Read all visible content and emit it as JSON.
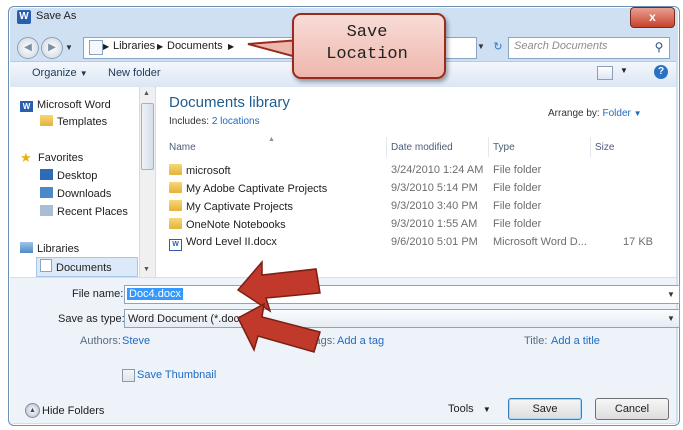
{
  "window": {
    "title": "Save As",
    "close_glyph": "x"
  },
  "address_bar": {
    "crumbs": [
      "Libraries",
      "Documents"
    ],
    "search_placeholder": "Search Documents"
  },
  "toolbar": {
    "organize": "Organize",
    "new_folder": "New folder"
  },
  "nav_pane": {
    "items": [
      {
        "label": "Microsoft Word",
        "icon": "word-icon"
      },
      {
        "label": "Templates",
        "icon": "folder-icon"
      },
      {
        "label": "Favorites",
        "icon": "star-icon"
      },
      {
        "label": "Desktop",
        "icon": "desktop-icon"
      },
      {
        "label": "Downloads",
        "icon": "downloads-icon"
      },
      {
        "label": "Recent Places",
        "icon": "recent-places-icon"
      },
      {
        "label": "Libraries",
        "icon": "libraries-icon"
      },
      {
        "label": "Documents",
        "icon": "documents-icon"
      }
    ]
  },
  "library": {
    "title": "Documents library",
    "includes_label": "Includes:",
    "includes_link": "2 locations",
    "arrange_label": "Arrange by:",
    "arrange_value": "Folder"
  },
  "columns": [
    "Name",
    "Date modified",
    "Type",
    "Size"
  ],
  "files": [
    {
      "name": "microsoft",
      "date": "3/24/2010 1:24 AM",
      "type": "File folder",
      "size": "",
      "icon": "folder-icon"
    },
    {
      "name": "My Adobe Captivate Projects",
      "date": "9/3/2010 5:14 PM",
      "type": "File folder",
      "size": "",
      "icon": "folder-icon"
    },
    {
      "name": "My Captivate Projects",
      "date": "9/3/2010 3:40 PM",
      "type": "File folder",
      "size": "",
      "icon": "folder-icon"
    },
    {
      "name": "OneNote Notebooks",
      "date": "9/3/2010 1:55 AM",
      "type": "File folder",
      "size": "",
      "icon": "folder-icon"
    },
    {
      "name": "Word Level II.docx",
      "date": "9/6/2010 5:01 PM",
      "type": "Microsoft Word D...",
      "size": "17 KB",
      "icon": "word-document-icon"
    }
  ],
  "form": {
    "file_name_label": "File name:",
    "file_name_value": "Doc4.docx",
    "save_as_type_label": "Save as type:",
    "save_as_type_value": "Word Document (*.docx)",
    "authors_label": "Authors:",
    "authors_value": "Steve",
    "tags_label": "Tags:",
    "tags_value": "Add a tag",
    "title_label": "Title:",
    "title_value": "Add a title",
    "thumbnail_label": "Save Thumbnail"
  },
  "footer": {
    "hide_folders": "Hide Folders",
    "tools": "Tools",
    "save": "Save",
    "cancel": "Cancel"
  },
  "callout": {
    "text": "Save\nLocation"
  },
  "colors": {
    "accent": "#1e6ac4",
    "arrow": "#c0392b",
    "window_frame": "#cfe0f3"
  }
}
